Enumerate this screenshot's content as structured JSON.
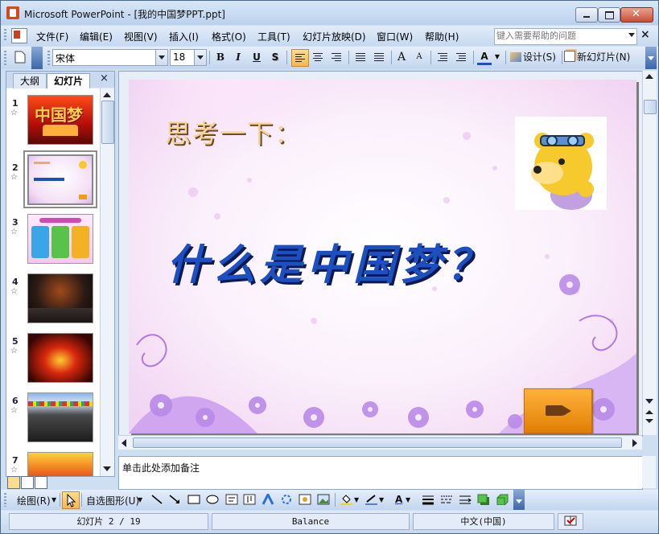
{
  "window": {
    "title": "Microsoft PowerPoint - [我的中国梦PPT.ppt]"
  },
  "menubar": {
    "items": [
      "文件(F)",
      "编辑(E)",
      "视图(V)",
      "插入(I)",
      "格式(O)",
      "工具(T)",
      "幻灯片放映(D)",
      "窗口(W)",
      "帮助(H)"
    ],
    "help_placeholder": "键入需要帮助的问题",
    "close_glyph": "×"
  },
  "toolbar": {
    "font_name": "宋体",
    "font_size": "18",
    "bold": "B",
    "italic": "I",
    "underline": "U",
    "shadow": "S",
    "design_label": "设计(S)",
    "new_slide_label": "新幻灯片(N)",
    "grow_font": "A",
    "shrink_font": "A",
    "font_color": "A"
  },
  "left_panel": {
    "tab_outline": "大纲",
    "tab_slides": "幻灯片",
    "close_glyph": "×",
    "selected_index": 2,
    "slides": [
      {
        "num": "1",
        "star": "☆",
        "label": "中国梦"
      },
      {
        "num": "2",
        "star": "☆",
        "label": ""
      },
      {
        "num": "3",
        "star": "☆",
        "label": ""
      },
      {
        "num": "4",
        "star": "☆",
        "label": ""
      },
      {
        "num": "5",
        "star": "☆",
        "label": ""
      },
      {
        "num": "6",
        "star": "☆",
        "label": ""
      },
      {
        "num": "7",
        "star": "☆",
        "label": ""
      }
    ]
  },
  "slide": {
    "heading": "思考一下：",
    "question": "什么是中国梦？",
    "bear_icon": "cartoon-bear",
    "video_icon": "video-camera"
  },
  "notes": {
    "placeholder": "单击此处添加备注"
  },
  "drawbar": {
    "draw_label": "绘图(R)",
    "autoshapes_label": "自选图形(U)"
  },
  "statusbar": {
    "slide_info": "幻灯片 2 / 19",
    "template": "Balance",
    "language": "中文(中国)"
  },
  "colors": {
    "accent": "#1c4fc0",
    "heading": "#f7d493",
    "video_button": "#f39a17"
  }
}
